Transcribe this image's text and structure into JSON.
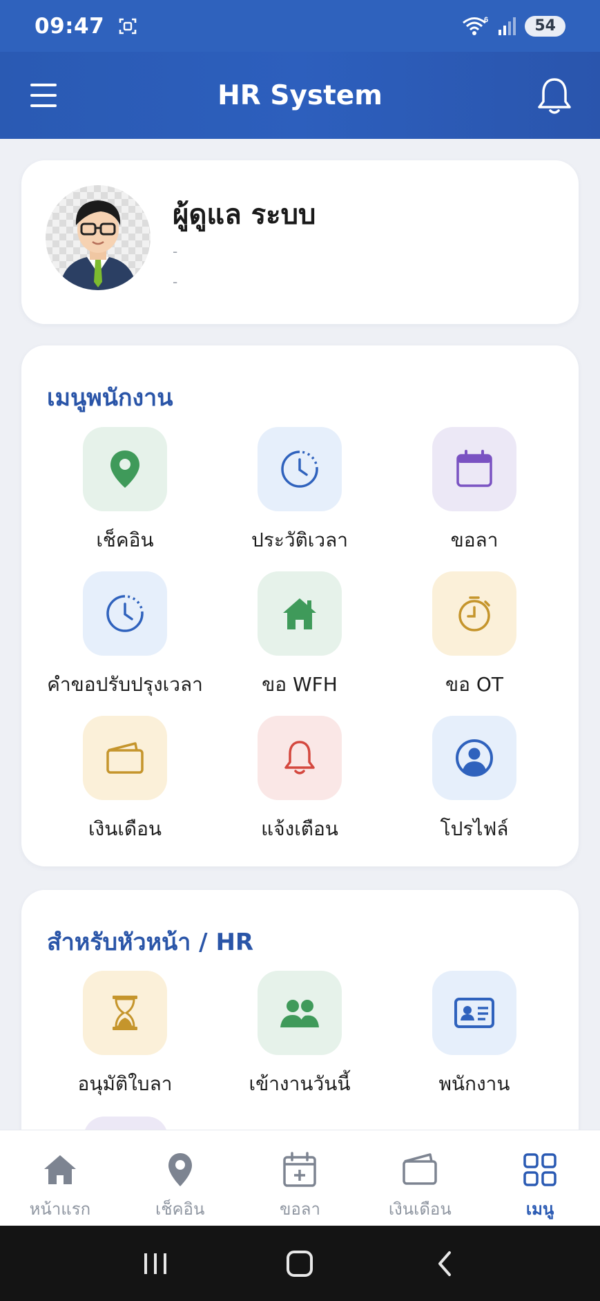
{
  "status_bar": {
    "time": "09:47",
    "battery": "54",
    "wifi_badge": "6",
    "icons": [
      "screenshot-icon",
      "wifi-icon",
      "signal-icon"
    ]
  },
  "app_bar": {
    "title": "HR System",
    "icons": [
      "menu-icon",
      "bell-icon"
    ]
  },
  "profile": {
    "name": "ผู้ดูแล ระบบ",
    "line1": "-",
    "line2": "-"
  },
  "employee_menu": {
    "title": "เมนูพนักงาน",
    "items": [
      {
        "label": "เช็คอิน",
        "icon": "map-pin-icon",
        "color": "#3f9a5a"
      },
      {
        "label": "ประวัติเวลา",
        "icon": "clock-history-icon",
        "color": "#2f62bd"
      },
      {
        "label": "ขอลา",
        "icon": "calendar-icon",
        "color": "#7a52c2"
      },
      {
        "label": "คำขอปรับปรุงเวลา",
        "icon": "clock-history-icon",
        "color": "#2f62bd"
      },
      {
        "label": "ขอ WFH",
        "icon": "house-icon",
        "color": "#3f9a5a"
      },
      {
        "label": "ขอ OT",
        "icon": "stopwatch-icon",
        "color": "#c5952c"
      },
      {
        "label": "เงินเดือน",
        "icon": "wallet-icon",
        "color": "#c5952c"
      },
      {
        "label": "แจ้งเตือน",
        "icon": "bell-icon",
        "color": "#d4483f"
      },
      {
        "label": "โปรไฟล์",
        "icon": "user-circle-icon",
        "color": "#2f62bd"
      }
    ]
  },
  "manager_menu": {
    "title": "สำหรับหัวหน้า / HR",
    "items": [
      {
        "label": "อนุมัติใบลา",
        "icon": "hourglass-icon",
        "color": "#c5952c"
      },
      {
        "label": "เข้างานวันนี้",
        "icon": "people-icon",
        "color": "#3f9a5a"
      },
      {
        "label": "พนักงาน",
        "icon": "id-card-icon",
        "color": "#2f62bd"
      }
    ]
  },
  "bottom_nav": {
    "items": [
      {
        "label": "หน้าแรก",
        "icon": "home-icon",
        "active": false
      },
      {
        "label": "เช็คอิน",
        "icon": "map-pin-icon",
        "active": false
      },
      {
        "label": "ขอลา",
        "icon": "calendar-plus-icon",
        "active": false
      },
      {
        "label": "เงินเดือน",
        "icon": "wallet-icon",
        "active": false
      },
      {
        "label": "เมนู",
        "icon": "grid-icon",
        "active": true
      }
    ]
  },
  "colors": {
    "primary": "#2f62bd",
    "background": "#eef0f5",
    "section_title": "#2a55a8"
  }
}
